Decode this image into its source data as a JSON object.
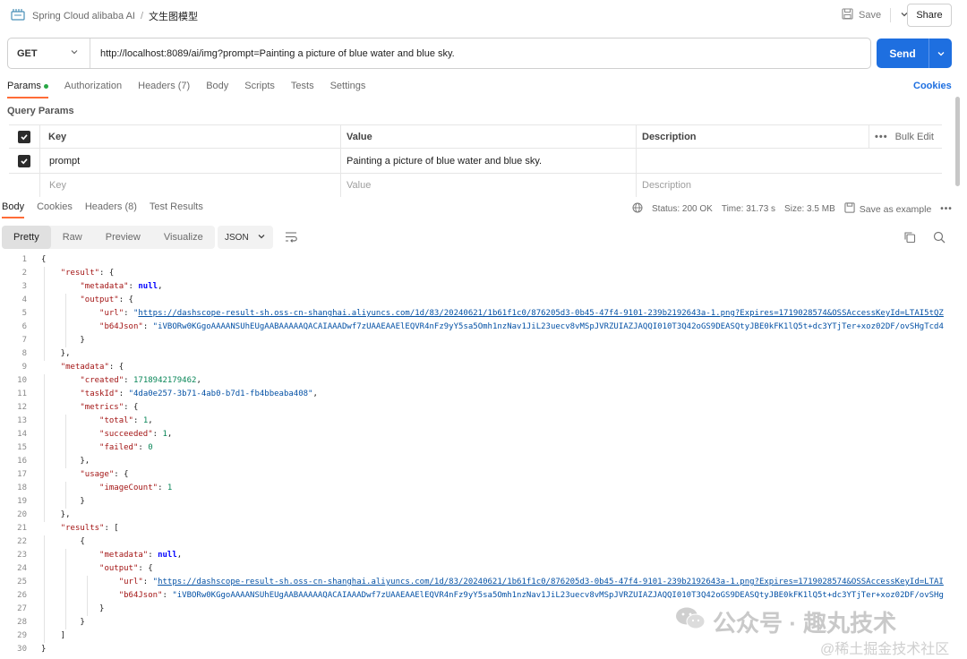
{
  "header": {
    "collection": "Spring Cloud alibaba AI",
    "separator": "/",
    "request_name": "文生图模型",
    "save_label": "Save",
    "share_label": "Share"
  },
  "request": {
    "method": "GET",
    "url": "http://localhost:8089/ai/img?prompt=Painting a picture of blue water and blue sky.",
    "send_label": "Send"
  },
  "request_tabs": [
    "Params",
    "Authorization",
    "Headers (7)",
    "Body",
    "Scripts",
    "Tests",
    "Settings"
  ],
  "cookies_label": "Cookies",
  "query_params": {
    "title": "Query Params",
    "headers": {
      "key": "Key",
      "value": "Value",
      "description": "Description",
      "bulk_edit": "Bulk Edit"
    },
    "rows": [
      {
        "key": "prompt",
        "value": "Painting a picture of blue water and blue sky.",
        "description": ""
      }
    ],
    "placeholder": {
      "key": "Key",
      "value": "Value",
      "description": "Description"
    }
  },
  "response_tabs": [
    "Body",
    "Cookies",
    "Headers (8)",
    "Test Results"
  ],
  "status": {
    "status": "Status: 200 OK",
    "time": "Time: 31.73 s",
    "size": "Size: 3.5 MB",
    "save_example": "Save as example"
  },
  "format_tabs": [
    "Pretty",
    "Raw",
    "Preview",
    "Visualize"
  ],
  "format_select": "JSON",
  "code_lines": [
    {
      "n": "1",
      "html": "{"
    },
    {
      "n": "2",
      "html": "    <span class=\"k\">\"result\"</span>: {"
    },
    {
      "n": "3",
      "html": "        <span class=\"k\">\"metadata\"</span>: <span class=\"kw\">null</span>,"
    },
    {
      "n": "4",
      "html": "        <span class=\"k\">\"output\"</span>: {"
    },
    {
      "n": "5",
      "html": "            <span class=\"k\">\"url\"</span>: <span class=\"s\">\"<span class=\"lnk\">https://dashscope-result-sh.oss-cn-shanghai.aliyuncs.com/1d/83/20240621/1b61f1c0/876205d3-0b45-47f4-9101-239b2192643a-1.png?Expires=1719028574&amp;OSSAccessKeyId=LTAI5tQZ</span></span>"
    },
    {
      "n": "6",
      "html": "            <span class=\"k\">\"b64Json\"</span>: <span class=\"s\">\"iVBORw0KGgoAAAANSUhEUgAABAAAAAQACAIAAADwf7zUAAEAAElEQVR4nFz9yY5sa5Omh1nzNav1JiL23uecv8vMSpJVRZUIAZJAQQI010T3Q42oGS9DEASQtyJBE0kFK1lQ5t+dc3YTjTer+xoz02DF/ovSHgTcd4</span>"
    },
    {
      "n": "7",
      "html": "        }"
    },
    {
      "n": "8",
      "html": "    },"
    },
    {
      "n": "9",
      "html": "    <span class=\"k\">\"metadata\"</span>: {"
    },
    {
      "n": "10",
      "html": "        <span class=\"k\">\"created\"</span>: <span class=\"n\">1718942179462</span>,"
    },
    {
      "n": "11",
      "html": "        <span class=\"k\">\"taskId\"</span>: <span class=\"s\">\"4da0e257-3b71-4ab0-b7d1-fb4bbeaba408\"</span>,"
    },
    {
      "n": "12",
      "html": "        <span class=\"k\">\"metrics\"</span>: {"
    },
    {
      "n": "13",
      "html": "            <span class=\"k\">\"total\"</span>: <span class=\"n\">1</span>,"
    },
    {
      "n": "14",
      "html": "            <span class=\"k\">\"succeeded\"</span>: <span class=\"n\">1</span>,"
    },
    {
      "n": "15",
      "html": "            <span class=\"k\">\"failed\"</span>: <span class=\"n\">0</span>"
    },
    {
      "n": "16",
      "html": "        },"
    },
    {
      "n": "17",
      "html": "        <span class=\"k\">\"usage\"</span>: {"
    },
    {
      "n": "18",
      "html": "            <span class=\"k\">\"imageCount\"</span>: <span class=\"n\">1</span>"
    },
    {
      "n": "19",
      "html": "        }"
    },
    {
      "n": "20",
      "html": "    },"
    },
    {
      "n": "21",
      "html": "    <span class=\"k\">\"results\"</span>: ["
    },
    {
      "n": "22",
      "html": "        {"
    },
    {
      "n": "23",
      "html": "            <span class=\"k\">\"metadata\"</span>: <span class=\"kw\">null</span>,"
    },
    {
      "n": "24",
      "html": "            <span class=\"k\">\"output\"</span>: {"
    },
    {
      "n": "25",
      "html": "                <span class=\"k\">\"url\"</span>: <span class=\"s\">\"<span class=\"lnk\">https://dashscope-result-sh.oss-cn-shanghai.aliyuncs.com/1d/83/20240621/1b61f1c0/876205d3-0b45-47f4-9101-239b2192643a-1.png?Expires=1719028574&amp;OSSAccessKeyId=LTAI</span></span>"
    },
    {
      "n": "26",
      "html": "                <span class=\"k\">\"b64Json\"</span>: <span class=\"s\">\"iVBORw0KGgoAAAANSUhEUgAABAAAAAQACAIAAADwf7zUAAEAAElEQVR4nFz9yY5sa5Omh1nzNav1JiL23uecv8vMSpJVRZUIAZJAQQI010T3Q42oGS9DEASQtyJBE0kFK1lQ5t+dc3YTjTer+xoz02DF/ovSHg</span>"
    },
    {
      "n": "27",
      "html": "            }"
    },
    {
      "n": "28",
      "html": "        }"
    },
    {
      "n": "29",
      "html": "    ]"
    },
    {
      "n": "30",
      "html": "}"
    }
  ],
  "watermark": {
    "line1": "公众号 · 趣丸技术",
    "line2": "@稀土掘金技术社区"
  }
}
